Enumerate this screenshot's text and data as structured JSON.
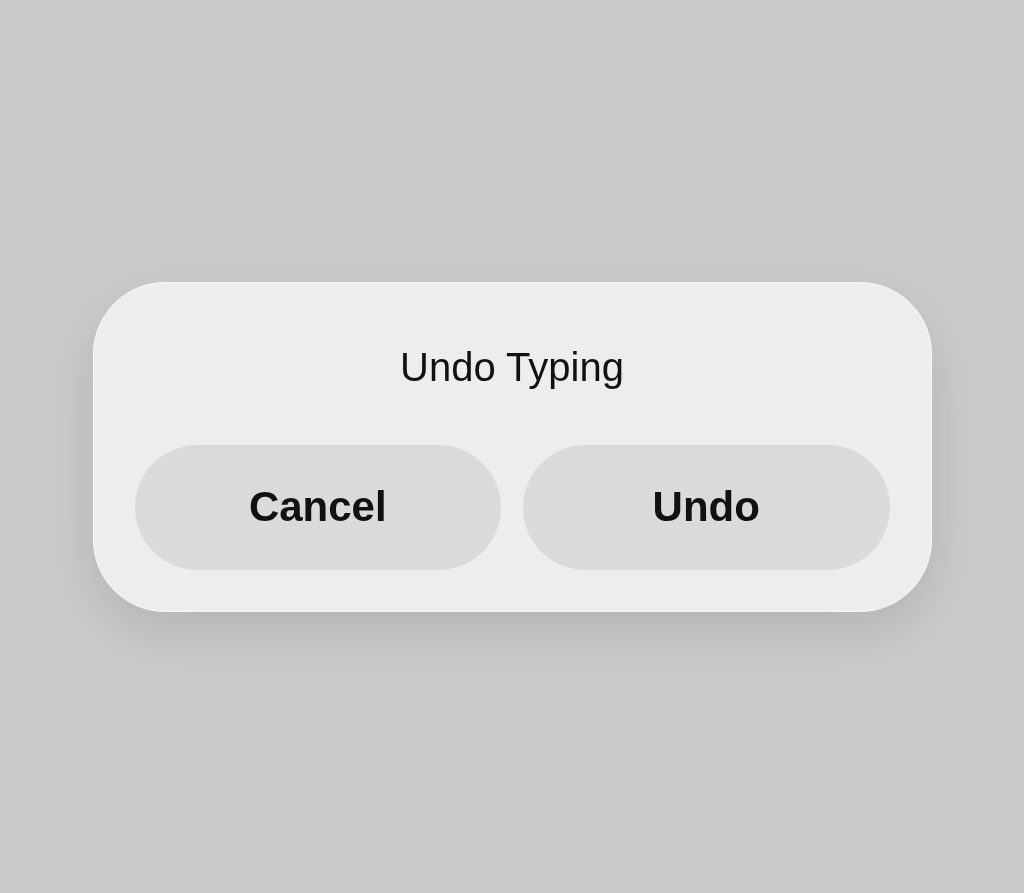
{
  "dialog": {
    "title": "Undo Typing",
    "buttons": [
      {
        "label": "Cancel"
      },
      {
        "label": "Undo"
      }
    ]
  }
}
